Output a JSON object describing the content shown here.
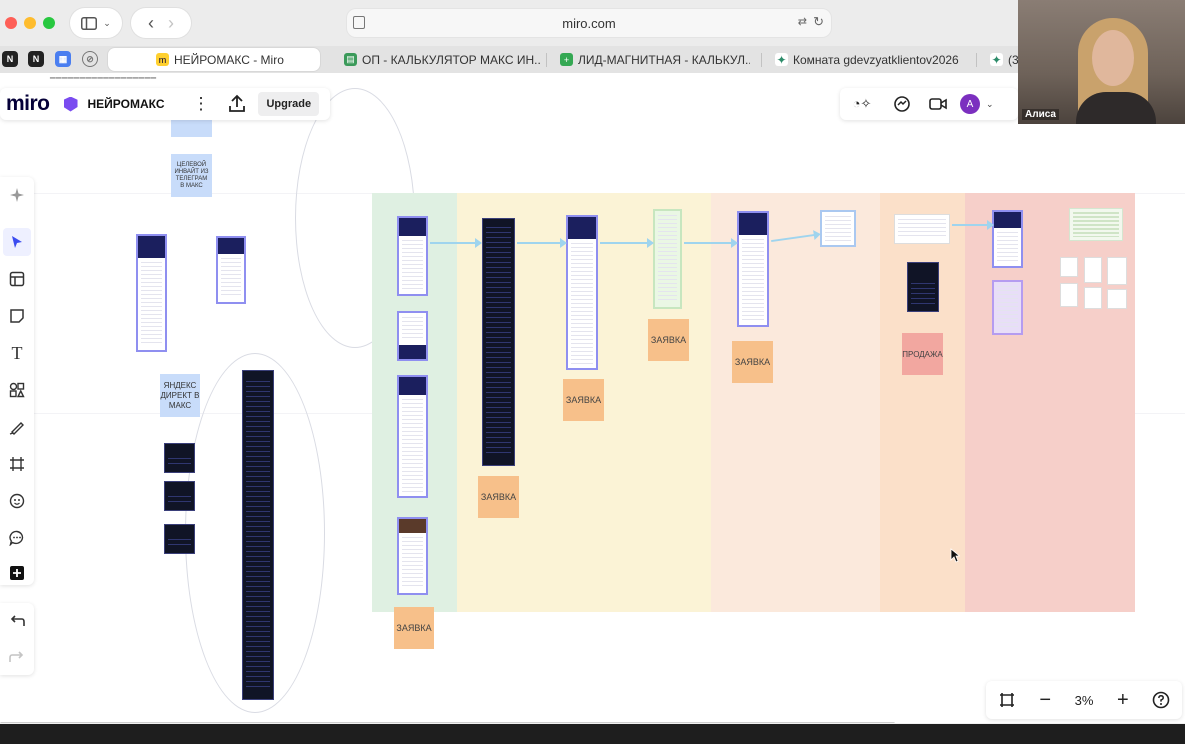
{
  "browser": {
    "url": "miro.com",
    "tabs": [
      {
        "label": "НЕЙРОМАКС - Miro",
        "active": true
      },
      {
        "label": "ОП - КАЛЬКУЛЯТОР МАКС ИН..."
      },
      {
        "label": "ЛИД-МАГНИТНАЯ - КАЛЬКУЛ..."
      },
      {
        "label": "Комната gdevzyatklientov2026"
      },
      {
        "label": "(3"
      }
    ]
  },
  "miro": {
    "logo": "miro",
    "board_name": "НЕЙРОМАКС",
    "upgrade_label": "Upgrade",
    "zoom_level": "3%",
    "avatar_initial": "А"
  },
  "board": {
    "sticky_telegram": "ЦЕЛЕВОЙ ИНВАЙТ ИЗ ТЕЛЕГРАМ В МАКС",
    "sticky_yandex": "ЯНДЕКС ДИРЕКТ В МАКС",
    "sticky_zayavka_1": "ЗАЯВКА",
    "sticky_zayavka_2": "ЗАЯВКА",
    "sticky_zayavka_3": "ЗАЯВКА",
    "sticky_zayavka_4": "ЗАЯВКА",
    "sticky_zayavka_5": "ЗАЯВКА",
    "sticky_prodazha": "ПРОДАЖА",
    "column_colors": [
      "#dff0e2",
      "#fbf3d6",
      "#fbf3d6",
      "#fbf3d6",
      "#fbe9dc",
      "#fbe9dc",
      "#fbe0c9",
      "#f6cfc9",
      "#f6cfc9"
    ]
  },
  "video": {
    "participant_name": "Алиса"
  }
}
